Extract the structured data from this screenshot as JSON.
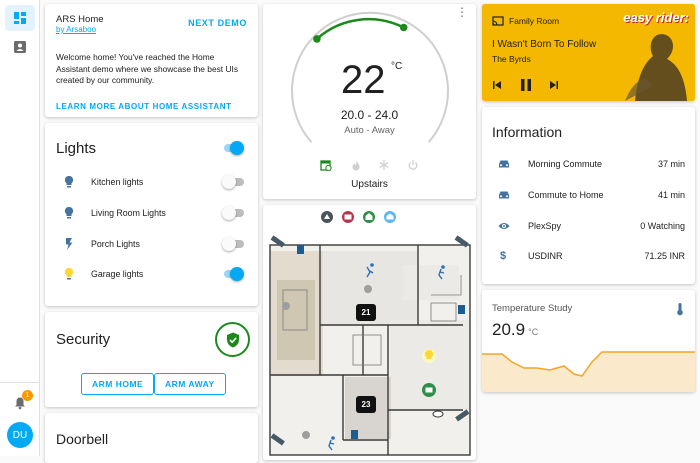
{
  "sidebar": {
    "avatar_initials": "DU",
    "notification_count": "1"
  },
  "demo_card": {
    "title": "ARS Home",
    "author": "by Arsaboo",
    "next_demo": "NEXT DEMO",
    "welcome": "Welcome home! You've reached the Home Assistant demo where we showcase the best UIs created by our community.",
    "learn_more": "LEARN MORE ABOUT HOME ASSISTANT"
  },
  "lights": {
    "title": "Lights",
    "items": [
      {
        "label": "Kitchen lights",
        "on": false
      },
      {
        "label": "Living Room Lights",
        "on": false
      },
      {
        "label": "Porch Lights",
        "on": false
      },
      {
        "label": "Garage lights",
        "on": true
      }
    ]
  },
  "security": {
    "title": "Security",
    "arm_home": "ARM HOME",
    "arm_away": "ARM AWAY"
  },
  "doorbell": {
    "title": "Doorbell"
  },
  "thermostat": {
    "temperature": "22",
    "unit": "°C",
    "range": "20.0 - 24.0",
    "mode": "Auto - Away",
    "name": "Upstairs"
  },
  "floorplan": {
    "badges": [
      "21",
      "23"
    ]
  },
  "media": {
    "room": "Family Room",
    "song": "I Wasn't Born To Follow",
    "artist": "The Byrds",
    "artwork_text": "easy rider:"
  },
  "information": {
    "title": "Information",
    "rows": [
      {
        "icon": "car-icon",
        "label": "Morning Commute",
        "value": "37 min"
      },
      {
        "icon": "car-icon",
        "label": "Commute to Home",
        "value": "41 min"
      },
      {
        "icon": "eye-icon",
        "label": "PlexSpy",
        "value": "0 Watching"
      },
      {
        "icon": "dollar-icon",
        "label": "USDINR",
        "value": "71.25 INR"
      }
    ]
  },
  "temperature_study": {
    "title": "Temperature Study",
    "value": "20.9",
    "unit": "°C"
  },
  "colors": {
    "accent": "#03a9f4",
    "green": "#1b8a1b",
    "yellow": "#ffc107",
    "media_bg": "#f5b800",
    "graph": "#f5a623"
  }
}
